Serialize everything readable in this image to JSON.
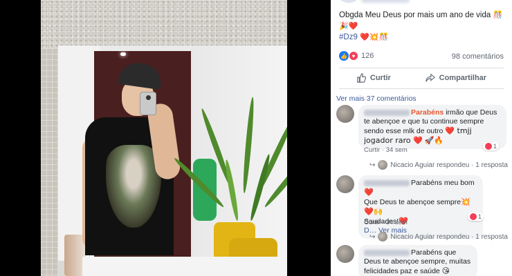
{
  "post": {
    "caption_text": "Obgda Meu Deus por mais um ano de vida",
    "caption_emojis": "🎊🎉❤️",
    "hashtag": "#Dz9",
    "hashtag_emojis": "❤️💥🎊",
    "reaction_count": "126",
    "comments_count": "98 comentários",
    "like_label": "Curtir",
    "share_label": "Compartilhar"
  },
  "comments_section": {
    "see_more": "Ver mais 37 comentários",
    "comments": [
      {
        "name_visible": "Parabéns",
        "text": "irmão que Deus te abençoe e que tu continue sempre sendo esse mlk de outro",
        "text_end": "❤️ tmjj jogador raro ❤️",
        "emoji_tail": "🚀🔥",
        "like": "Curtir",
        "time": "34 sem",
        "reactions": "1",
        "reply": "Nicacio Aguiar respondeu · 1 resposta"
      },
      {
        "text_line1": "Parabéns meu bom",
        "text_line2": "Que Deus te abençoe sempre",
        "text_line3": "Saudades!",
        "see_more": "D… Ver mais",
        "like": "Curtir",
        "time": "34 sem",
        "reactions": "1",
        "reply": "Nicacio Aguiar respondeu · 1 resposta"
      },
      {
        "text": "Parabéns que Deus te abençoe sempre, muitas felicidades paz e saúde"
      }
    ]
  },
  "colors": {
    "link": "#385898",
    "name_highlight": "#e4572e",
    "like_blue": "#1877f2",
    "love_red": "#f33e58"
  }
}
